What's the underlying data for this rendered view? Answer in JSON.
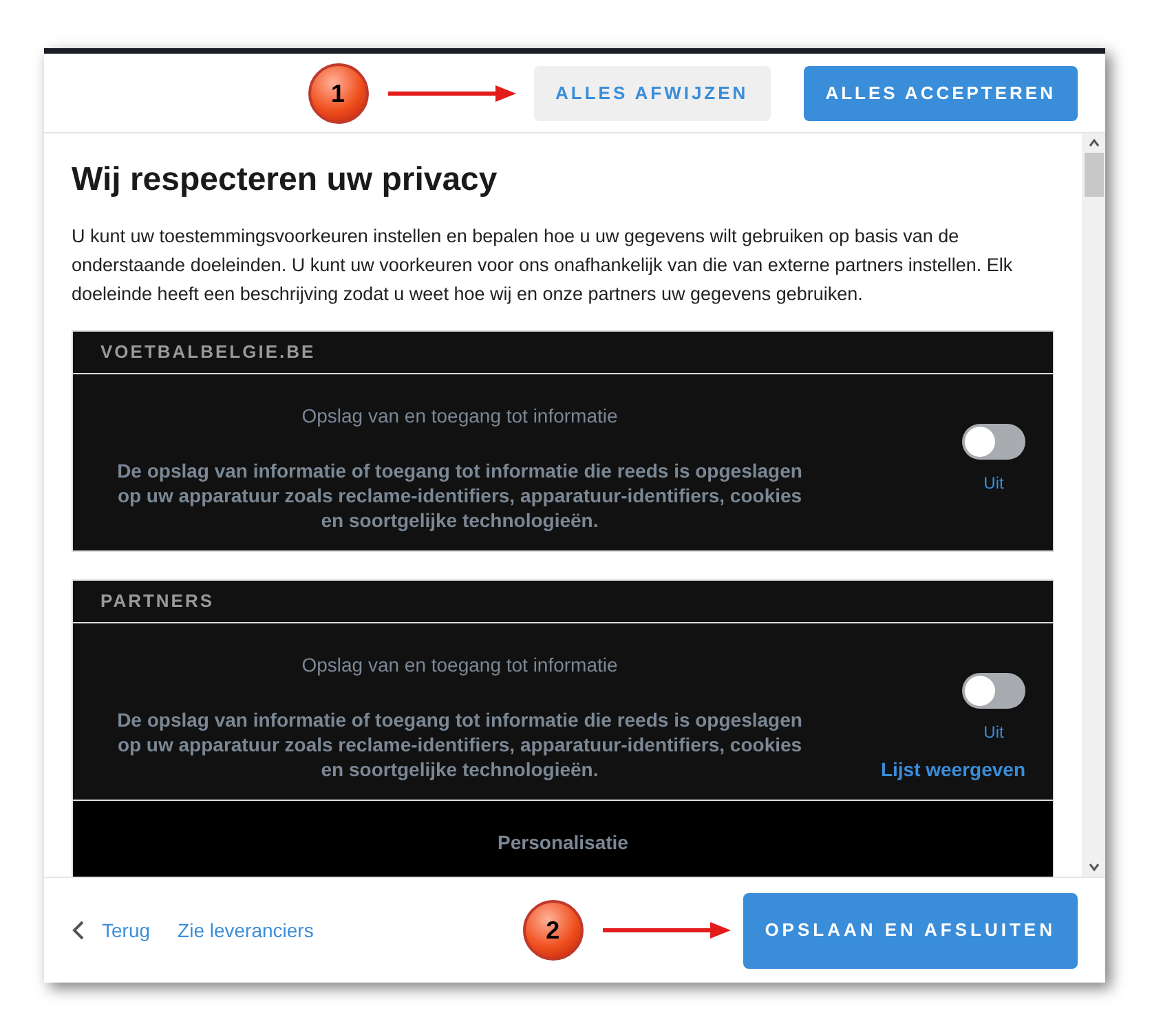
{
  "header": {
    "callout": "1",
    "buttons": [
      {
        "label": "ALLES AFWIJZEN",
        "kind": "secondary"
      },
      {
        "label": "ALLES ACCEPTEREN",
        "kind": "primary"
      }
    ]
  },
  "title": "Wij respecteren uw privacy",
  "intro": "U kunt uw toestemmingsvoorkeuren instellen en bepalen hoe u uw gegevens wilt gebruiken op basis van de onderstaande doeleinden. U kunt uw voorkeuren voor ons onafhankelijk van die van externe partners instellen. Elk doeleinde heeft een beschrijving zodat u weet hoe wij en onze partners uw gegevens gebruiken.",
  "sections": [
    {
      "heading": "VOETBALBELGIE.BE",
      "purposes": [
        {
          "title": "Opslag van en toegang tot informatie",
          "description": "De opslag van informatie of toegang tot informatie die reeds is opgeslagen op uw apparatuur zoals reclame-identifiers, apparatuur-identifiers, cookies en soortgelijke technologieën.",
          "on": false,
          "state_label": "Uit"
        }
      ]
    },
    {
      "heading": "PARTNERS",
      "purposes": [
        {
          "title": "Opslag van en toegang tot informatie",
          "description": "De opslag van informatie of toegang tot informatie die reeds is opgeslagen op uw apparatuur zoals reclame-identifiers, apparatuur-identifiers, cookies en soortgelijke technologieën.",
          "on": false,
          "state_label": "Uit",
          "link": "Lijst weergeven"
        },
        {
          "title": "Personalisatie"
        }
      ]
    }
  ],
  "footer": {
    "back": "Terug",
    "vendors": "Zie leveranciers",
    "callout": "2",
    "button": "OPSLAAN EN AFSLUITEN"
  }
}
